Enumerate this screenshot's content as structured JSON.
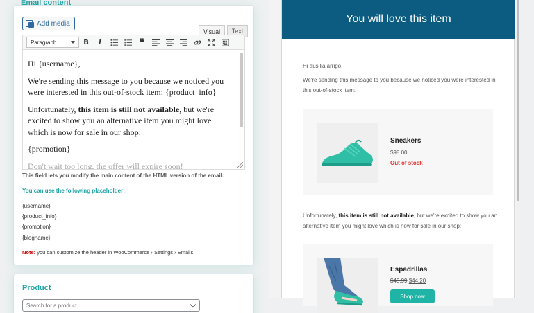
{
  "left": {
    "tab_title": "Email content",
    "add_media_label": "Add media",
    "tabs": {
      "visual": "Visual",
      "text": "Text"
    },
    "format_select": "Paragraph",
    "toolbar_icons": [
      "bold-icon",
      "italic-icon",
      "bullet-list-icon",
      "numbered-list-icon",
      "blockquote-icon",
      "align-left-icon",
      "align-center-icon",
      "align-right-icon",
      "link-icon",
      "fullscreen-icon",
      "toolbar-toggle-icon"
    ],
    "editor": {
      "greeting": "Hi {username},",
      "p1": "We're sending this message to you because we noticed you were interested in this out-of-stock item: {product_info}",
      "p2_a": "Unfortunately, ",
      "p2_b": "this item is still not available",
      "p2_c": ", but we're excited to show you an alternative item you might love which is now for sale in our shop:",
      "p3": "{promotion}",
      "p4": "Don't wait too long, the offer will expire soon!"
    },
    "help_main": "This field lets you modify the main content of the HTML version of the email.",
    "help_sub": "You can use the following placeholder:",
    "placeholders": [
      "{username}",
      "{product_info}",
      "{promotion}",
      "{blogname}"
    ],
    "note_label": "Note:",
    "note_text": " you can customize the header in WooCommerce › Settings › Emails.",
    "product_title": "Product",
    "product_search_placeholder": "Search for a product..."
  },
  "email": {
    "header": "You will love this item",
    "greeting": "Hi ausilia.arrigo,",
    "intro": "We're sending this message to you because we noticed you were interested in this out-of-stock item:",
    "product1": {
      "name": "Sneakers",
      "price": "$98.00",
      "stock": "Out of stock"
    },
    "middle_a": "Unfortunately, ",
    "middle_b": "this item is still not available",
    "middle_c": ", but we're excited to show you an alternative item you might love which is now for sale in our shop:",
    "product2": {
      "name": "Espadrillas",
      "old_price": "$45.99",
      "new_price": "$44.20",
      "button": "Shop now"
    }
  },
  "colors": {
    "teal": "#20a3a3",
    "header_blue": "#0b5c80",
    "out_of_stock": "#e3332f",
    "button": "#1fb4a5"
  }
}
